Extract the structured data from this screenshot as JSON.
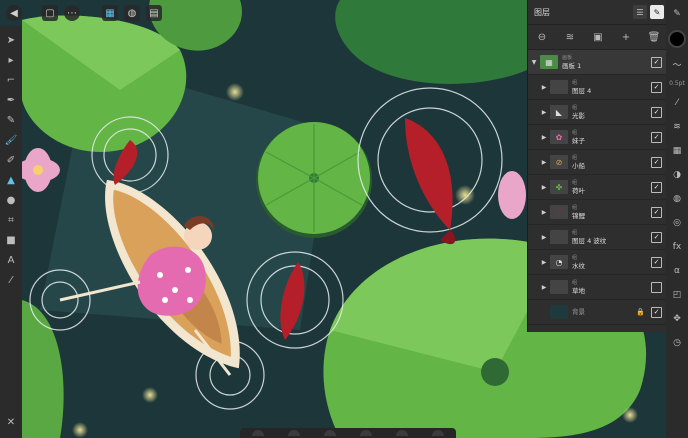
{
  "topbar": {
    "buttons": [
      {
        "icon": "back-icon",
        "glyph": "◀"
      },
      {
        "icon": "document-icon",
        "glyph": "▢"
      },
      {
        "icon": "more-icon",
        "glyph": "⋯"
      },
      {
        "icon": "pixel-persona-icon",
        "glyph": "▦"
      },
      {
        "icon": "adjust-persona-icon",
        "glyph": "◍"
      },
      {
        "icon": "export-persona-icon",
        "glyph": "▤"
      }
    ]
  },
  "tools": [
    {
      "name": "move-tool-icon",
      "glyph": "➤"
    },
    {
      "name": "node-tool-icon",
      "glyph": "▸"
    },
    {
      "name": "corner-tool-icon",
      "glyph": "⌐"
    },
    {
      "name": "pen-tool-icon",
      "glyph": "✒"
    },
    {
      "name": "pencil-tool-icon",
      "glyph": "✎"
    },
    {
      "name": "brush-tool-icon",
      "glyph": "🖌"
    },
    {
      "name": "paint-tool-icon",
      "glyph": "✐"
    },
    {
      "name": "fill-tool-icon",
      "glyph": "▲"
    },
    {
      "name": "transparency-tool-icon",
      "glyph": "●"
    },
    {
      "name": "crop-tool-icon",
      "glyph": "⌗"
    },
    {
      "name": "shape-tool-icon",
      "glyph": "■"
    },
    {
      "name": "text-tool-icon",
      "glyph": "A"
    },
    {
      "name": "eyedropper-tool-icon",
      "glyph": "⁄"
    }
  ],
  "close_glyph": "✕",
  "right_strip": {
    "brush_size": "0.5pt"
  },
  "layers_panel": {
    "title": "图层",
    "actions": [
      "⊖",
      "≋",
      "▣",
      "+",
      "🗑"
    ],
    "root": {
      "type": "画板",
      "name": "画板 1"
    },
    "layers": [
      {
        "type": "组",
        "name": "图层 4",
        "thumb": "",
        "checked": true
      },
      {
        "type": "组",
        "name": "光影",
        "thumb": "◣",
        "checked": true
      },
      {
        "type": "组",
        "name": "妹子",
        "thumb": "✿",
        "checked": true
      },
      {
        "type": "组",
        "name": "小船",
        "thumb": "⊘",
        "checked": true
      },
      {
        "type": "组",
        "name": "荷叶",
        "thumb": "✤",
        "checked": true
      },
      {
        "type": "组",
        "name": "锦鲤",
        "thumb": "⟋",
        "checked": true
      },
      {
        "type": "组",
        "name": "图层 4 波纹",
        "thumb": "",
        "checked": true
      },
      {
        "type": "组",
        "name": "水纹",
        "thumb": "◔",
        "checked": true
      },
      {
        "type": "组",
        "name": "草地",
        "thumb": "",
        "checked": false
      }
    ],
    "background": {
      "name": "背景",
      "checked": true
    }
  },
  "colors": {
    "water": "#1e3a3c",
    "lilypad": "#63b545",
    "lilypad_dark": "#2f7a3a",
    "koi": "#b51f2a",
    "dress": "#e46bb0",
    "boat": "#d9a15a",
    "accent": "#5fc3f0"
  }
}
